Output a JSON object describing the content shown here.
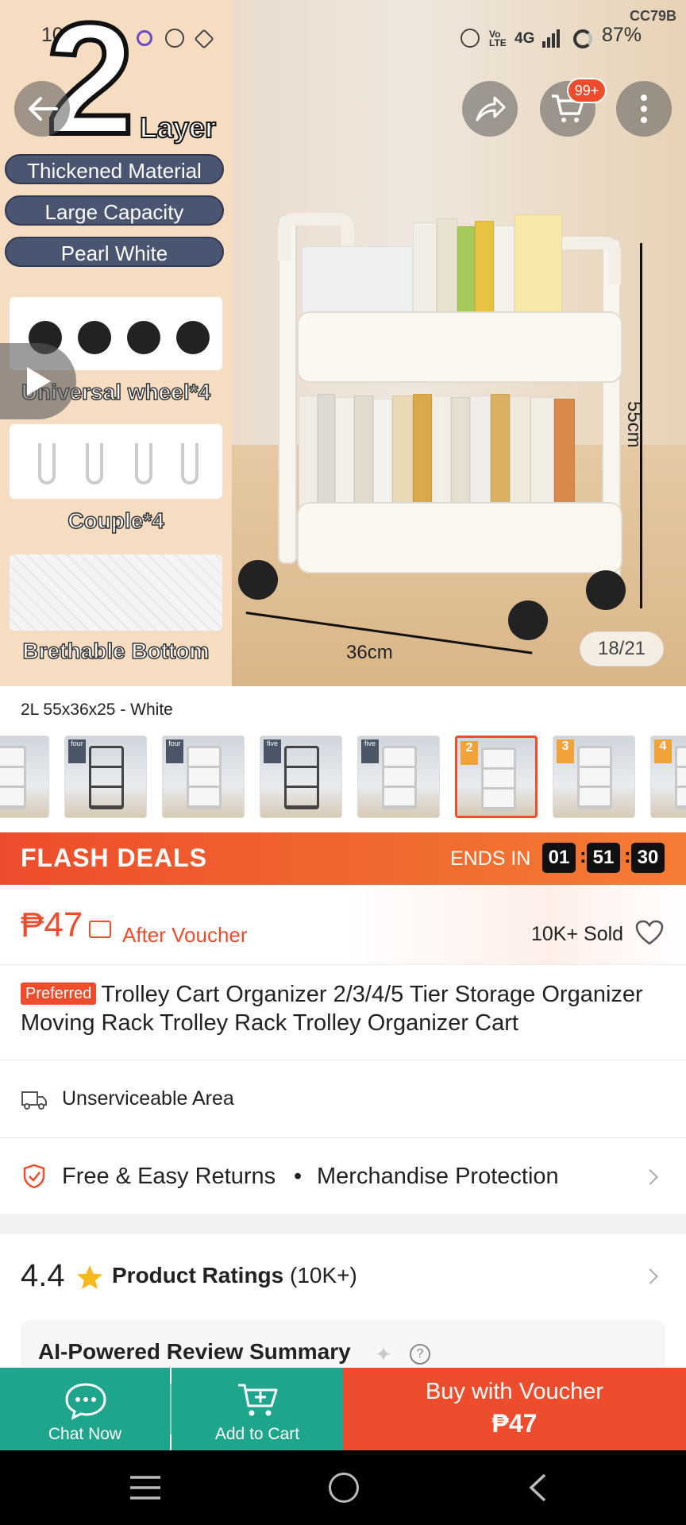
{
  "status_bar": {
    "time": "10:08",
    "battery": "87%",
    "network": "4G",
    "code": "CC79B"
  },
  "hero": {
    "banner_number": "2",
    "banner_word": "Layer",
    "pills": [
      "Thickened Material",
      "Large Capacity",
      "Pearl White"
    ],
    "features": [
      "Universal wheel*4",
      "Couple*4",
      "Brethable Bottom"
    ],
    "dimensions": {
      "height": "55cm",
      "width": "36cm"
    },
    "cart_badge": "99+",
    "image_counter": "18/21"
  },
  "variant": {
    "selected_name": "2L 55x36x25 - White",
    "thumbs": [
      {
        "tag": "",
        "rack": "white"
      },
      {
        "tag": "four",
        "rack": "black"
      },
      {
        "tag": "four",
        "rack": "white"
      },
      {
        "tag": "five",
        "rack": "black"
      },
      {
        "tag": "five",
        "rack": "white"
      },
      {
        "tag": "2",
        "rack": "white",
        "selected": true
      },
      {
        "tag": "3",
        "rack": "white"
      },
      {
        "tag": "4",
        "rack": "white"
      }
    ]
  },
  "flash": {
    "title": "FLASH DEALS",
    "ends_label": "ENDS IN",
    "hours": "01",
    "minutes": "51",
    "seconds": "30"
  },
  "price": {
    "amount": "₱47",
    "after_voucher": "After Voucher",
    "sold": "10K+ Sold"
  },
  "product": {
    "badge": "Preferred",
    "title": "Trolley Cart Organizer 2/3/4/5 Tier Storage Organizer Moving Rack Trolley Rack Trolley Organizer Cart"
  },
  "shipping": {
    "text": "Unserviceable Area"
  },
  "returns": {
    "left": "Free & Easy Returns",
    "dot": "•",
    "right": "Merchandise Protection"
  },
  "ratings": {
    "score": "4.4",
    "label": "Product Ratings",
    "count": "(10K+)",
    "ai_summary": "AI-Powered Review Summary"
  },
  "actions": {
    "chat": "Chat Now",
    "add_cart": "Add to Cart",
    "buy_line1": "Buy with Voucher",
    "buy_line2": "₱47"
  },
  "colors": {
    "accent": "#ee4d2d",
    "teal": "#1fa58b"
  }
}
